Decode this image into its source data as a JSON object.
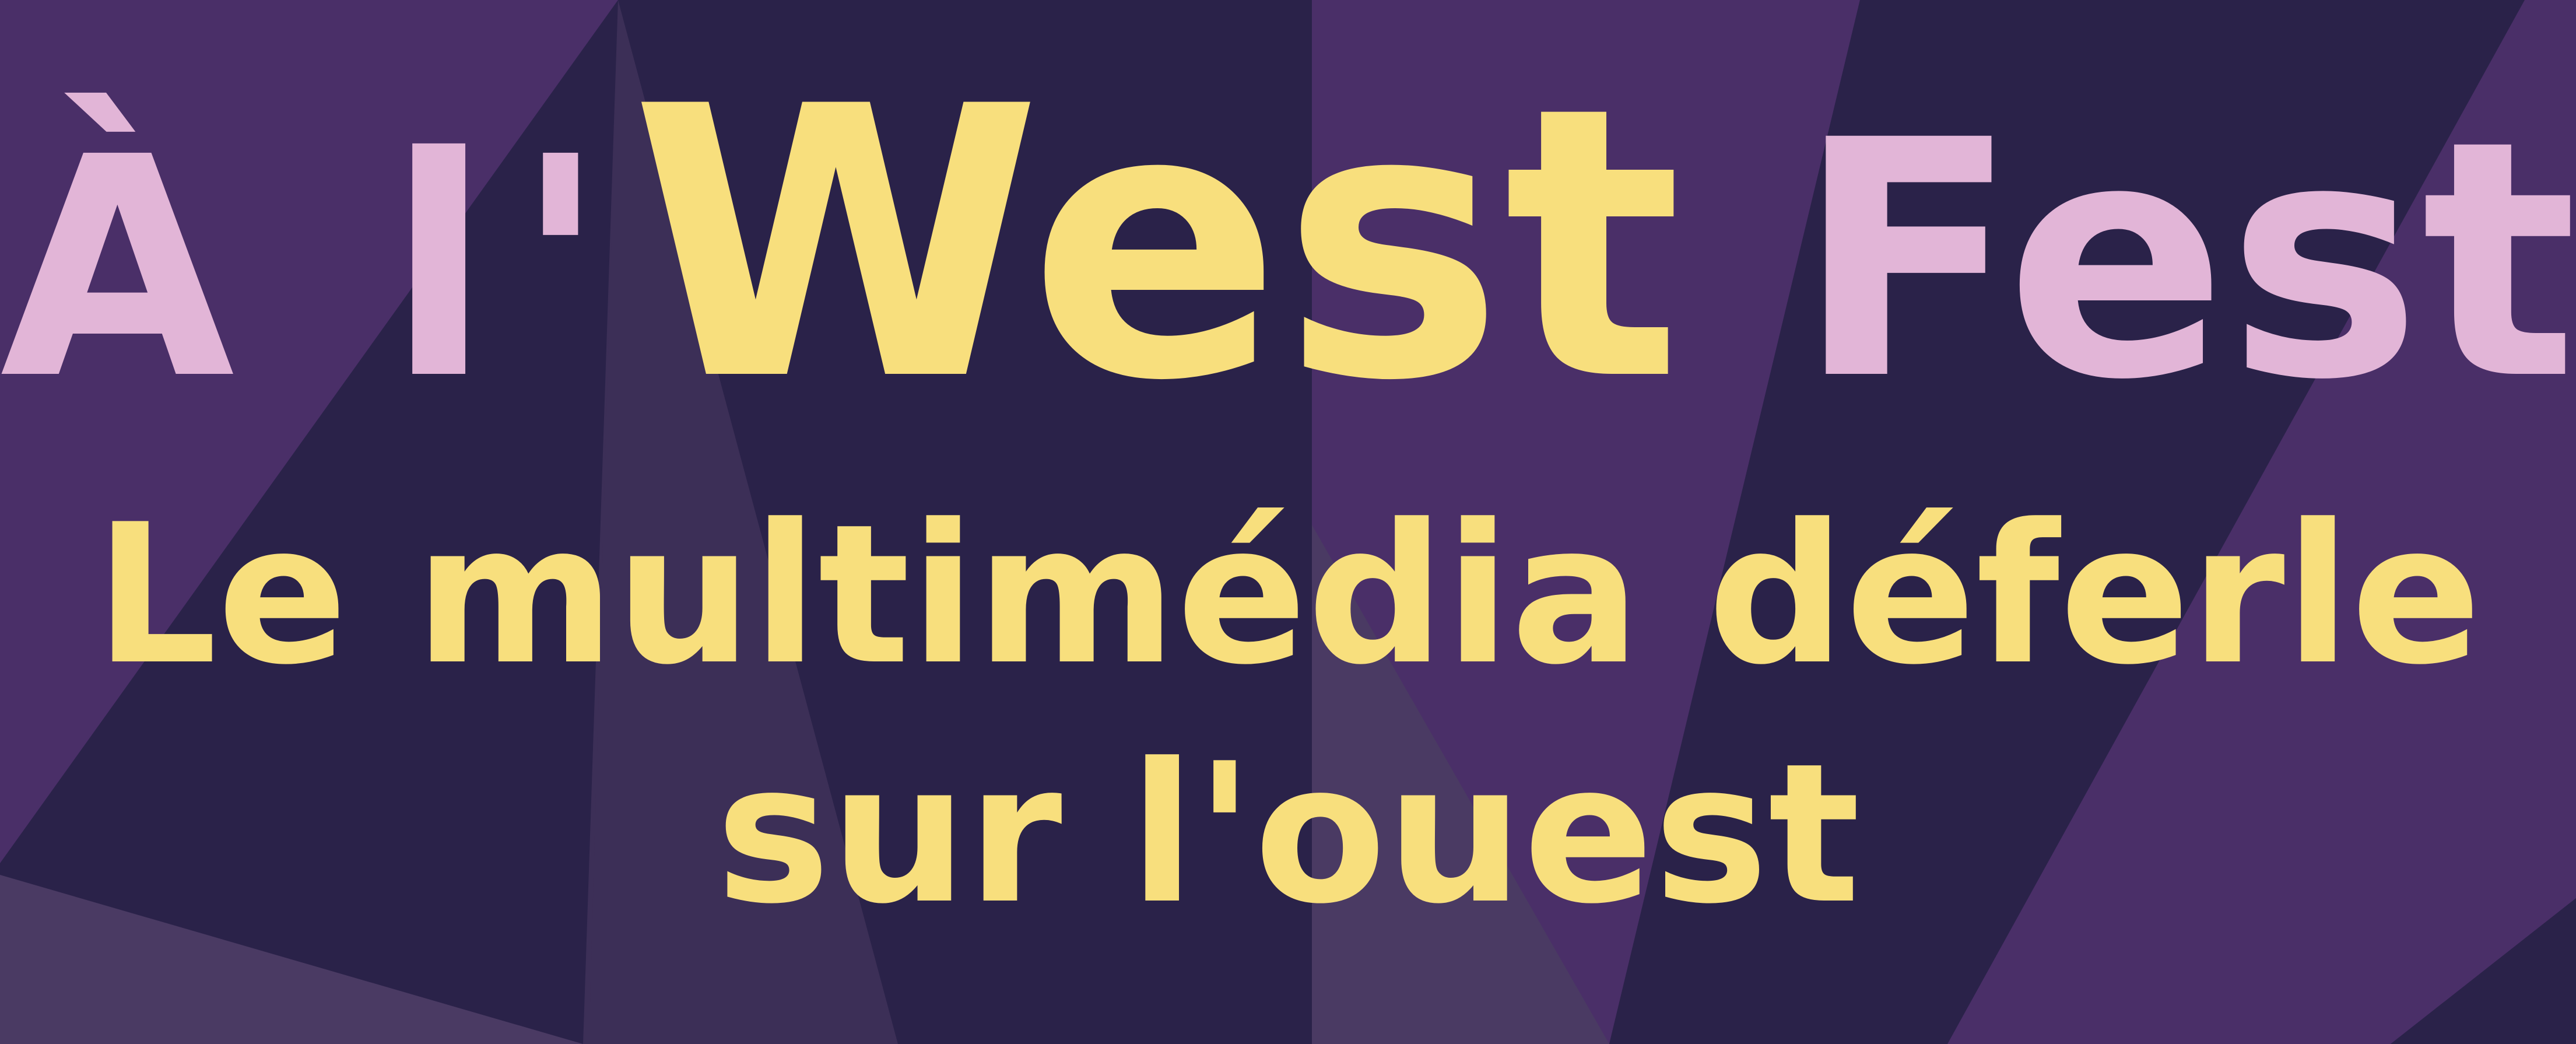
{
  "colors": {
    "background_dark": "#2a2249",
    "background_purple": "#4a2f68",
    "background_muted": "#4a3a63",
    "accent_yellow": "#f8df7d",
    "accent_pink": "#e2b5d7"
  },
  "poster": {
    "title": {
      "part_a": "À l'",
      "part_west": "West",
      "part_fest": " Fest"
    },
    "subtitle_line_1": "Le multimédia déferle",
    "subtitle_line_2": "sur l'ouest"
  }
}
